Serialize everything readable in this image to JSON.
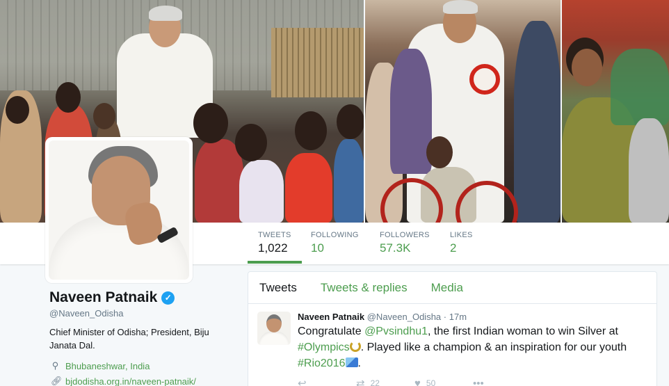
{
  "profile": {
    "name": "Naveen Patnaik",
    "handle": "@Naveen_Odisha",
    "bio": "Chief Minister of Odisha; President, Biju Janata Dal.",
    "location": "Bhubaneshwar, India",
    "website": "bjdodisha.org.in/naveen-patnaik/",
    "verified_icon": "verified-badge-icon"
  },
  "stats": [
    {
      "label": "TWEETS",
      "value": "1,022"
    },
    {
      "label": "FOLLOWING",
      "value": "10"
    },
    {
      "label": "FOLLOWERS",
      "value": "57.3K"
    },
    {
      "label": "LIKES",
      "value": "2"
    }
  ],
  "tabs": [
    "Tweets",
    "Tweets & replies",
    "Media"
  ],
  "tweet": {
    "name": "Naveen Patnaik",
    "handle": "@Naveen_Odisha",
    "time": "· 17m",
    "text_1": "Congratulate ",
    "mention": "@Pvsindhu1",
    "text_2": ", the first Indian woman to win Silver at ",
    "hashtag_1": "#Olympics",
    "text_3": ". Played like a champion & an inspiration for our youth ",
    "hashtag_2": "#Rio2016",
    "text_4": ".",
    "retweets": "22",
    "likes": "50"
  },
  "colors": {
    "accent": "#4c9d4e",
    "verified": "#1da1f2"
  }
}
